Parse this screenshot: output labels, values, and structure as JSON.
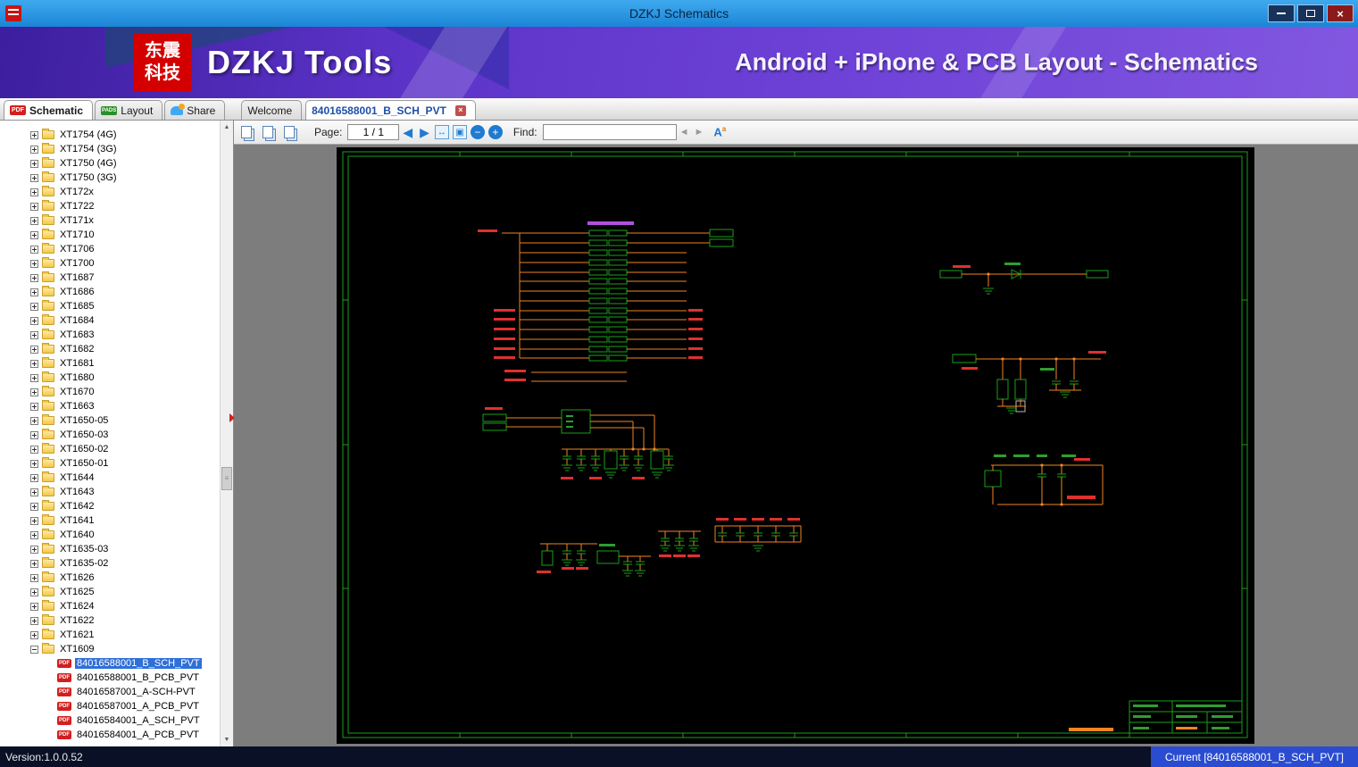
{
  "window": {
    "title": "DZKJ Schematics"
  },
  "banner": {
    "logo_line1": "东震",
    "logo_line2": "科技",
    "title": "DZKJ Tools",
    "subtitle": "Android + iPhone & PCB Layout - Schematics"
  },
  "tabs": {
    "group": [
      {
        "label": "Schematic",
        "badge": "PDF",
        "active": true
      },
      {
        "label": "Layout",
        "badge": "PADS",
        "active": false
      },
      {
        "label": "Share",
        "active": false
      }
    ],
    "documents": [
      {
        "label": "Welcome",
        "active": false
      },
      {
        "label": "84016588001_B_SCH_PVT",
        "active": true,
        "closable": true
      }
    ]
  },
  "toolbar": {
    "page_label": "Page:",
    "page_value": "1 / 1",
    "find_label": "Find:",
    "find_value": ""
  },
  "icons": {
    "back": "◀",
    "forward": "▶",
    "fit_width": "↔",
    "fit_page": "▣",
    "zoom_out": "−",
    "zoom_in": "+",
    "find_prev": "◄",
    "find_next": "►",
    "font": "A",
    "font_sup": "a",
    "scroll_up": "▲",
    "scroll_down": "▼",
    "close_tab": "×",
    "close_win": "×"
  },
  "tree": {
    "items": [
      {
        "label": "XT1754 (4G)",
        "kind": "folder"
      },
      {
        "label": "XT1754 (3G)",
        "kind": "folder"
      },
      {
        "label": "XT1750 (4G)",
        "kind": "folder"
      },
      {
        "label": "XT1750 (3G)",
        "kind": "folder"
      },
      {
        "label": "XT172x",
        "kind": "folder"
      },
      {
        "label": "XT1722",
        "kind": "folder"
      },
      {
        "label": "XT171x",
        "kind": "folder"
      },
      {
        "label": "XT1710",
        "kind": "folder"
      },
      {
        "label": "XT1706",
        "kind": "folder"
      },
      {
        "label": "XT1700",
        "kind": "folder"
      },
      {
        "label": "XT1687",
        "kind": "folder"
      },
      {
        "label": "XT1686",
        "kind": "folder"
      },
      {
        "label": "XT1685",
        "kind": "folder"
      },
      {
        "label": "XT1684",
        "kind": "folder"
      },
      {
        "label": "XT1683",
        "kind": "folder"
      },
      {
        "label": "XT1682",
        "kind": "folder"
      },
      {
        "label": "XT1681",
        "kind": "folder"
      },
      {
        "label": "XT1680",
        "kind": "folder"
      },
      {
        "label": "XT1670",
        "kind": "folder"
      },
      {
        "label": "XT1663",
        "kind": "folder"
      },
      {
        "label": "XT1650-05",
        "kind": "folder"
      },
      {
        "label": "XT1650-03",
        "kind": "folder"
      },
      {
        "label": "XT1650-02",
        "kind": "folder"
      },
      {
        "label": "XT1650-01",
        "kind": "folder"
      },
      {
        "label": "XT1644",
        "kind": "folder"
      },
      {
        "label": "XT1643",
        "kind": "folder"
      },
      {
        "label": "XT1642",
        "kind": "folder"
      },
      {
        "label": "XT1641",
        "kind": "folder"
      },
      {
        "label": "XT1640",
        "kind": "folder"
      },
      {
        "label": "XT1635-03",
        "kind": "folder"
      },
      {
        "label": "XT1635-02",
        "kind": "folder"
      },
      {
        "label": "XT1626",
        "kind": "folder"
      },
      {
        "label": "XT1625",
        "kind": "folder"
      },
      {
        "label": "XT1624",
        "kind": "folder"
      },
      {
        "label": "XT1622",
        "kind": "folder"
      },
      {
        "label": "XT1621",
        "kind": "folder"
      },
      {
        "label": "XT1609",
        "kind": "folder",
        "state": "expanded"
      },
      {
        "label": "84016588001_B_SCH_PVT",
        "kind": "pdf",
        "selected": true
      },
      {
        "label": "84016588001_B_PCB_PVT",
        "kind": "pdf"
      },
      {
        "label": "84016587001_A-SCH-PVT",
        "kind": "pdf"
      },
      {
        "label": "84016587001_A_PCB_PVT",
        "kind": "pdf"
      },
      {
        "label": "84016584001_A_SCH_PVT",
        "kind": "pdf"
      },
      {
        "label": "84016584001_A_PCB_PVT",
        "kind": "pdf"
      }
    ]
  },
  "statusbar": {
    "version": "Version:1.0.0.52",
    "current": "Current [84016588001_B_SCH_PVT]"
  },
  "schematic_colors": {
    "frame": "#18a018",
    "wire": "#f08424",
    "component": "#18a018",
    "net_label": "#e03030",
    "header": "#b050e0"
  }
}
